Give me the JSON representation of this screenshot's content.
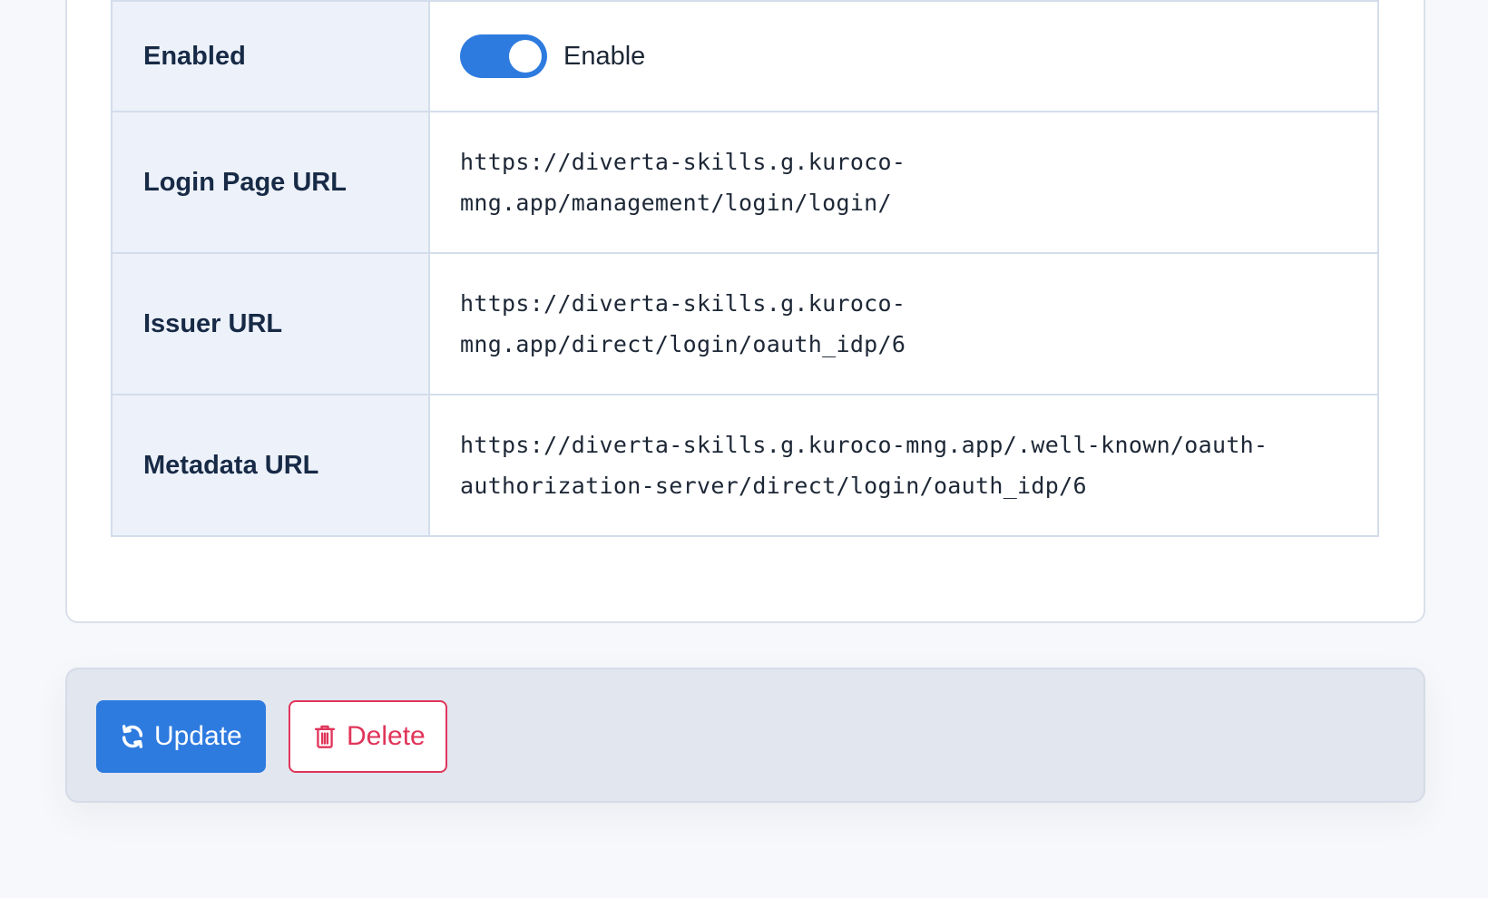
{
  "settings": {
    "rows": [
      {
        "label": "Enabled",
        "toggle_label": "Enable",
        "toggle_on": true
      },
      {
        "label": "Login Page URL",
        "value": "https://diverta-skills.g.kuroco-\nmng.app/management/login/login/"
      },
      {
        "label": "Issuer URL",
        "value": "https://diverta-skills.g.kuroco-\nmng.app/direct/login/oauth_idp/6"
      },
      {
        "label": "Metadata URL",
        "value": "https://diverta-skills.g.kuroco-mng.app/.well-known/oauth-\nauthorization-server/direct/login/oauth_idp/6"
      }
    ]
  },
  "actions": {
    "update_label": "Update",
    "update_icon": "refresh-icon",
    "delete_label": "Delete",
    "delete_icon": "trash-icon"
  },
  "colors": {
    "primary": "#2e7be0",
    "danger": "#e0355a",
    "label_bg": "#edf2fa",
    "border": "#d3ddeb"
  }
}
